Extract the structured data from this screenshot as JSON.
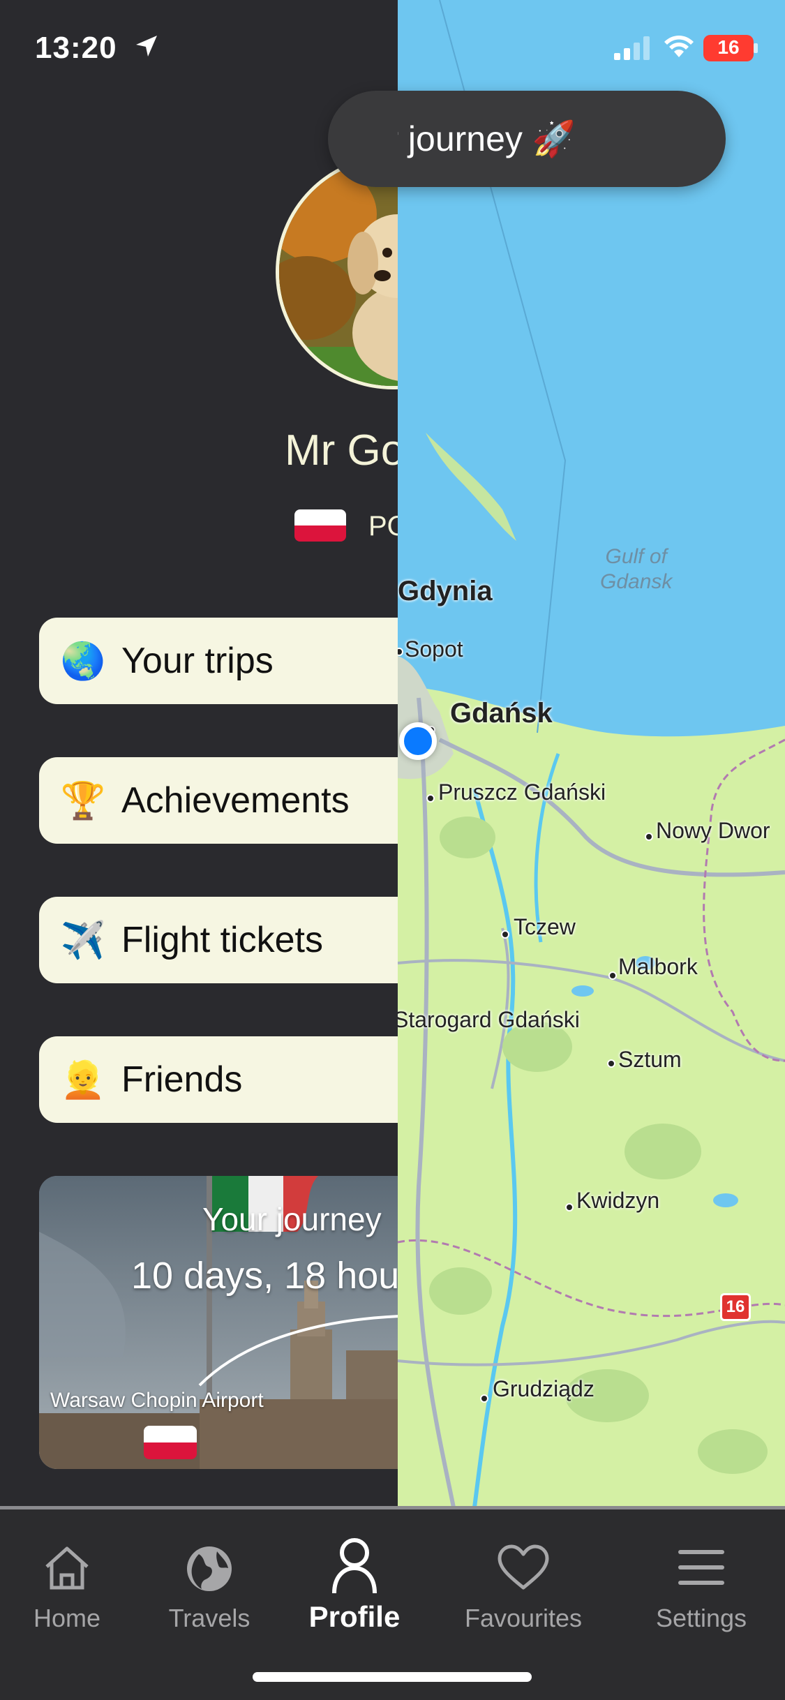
{
  "status_bar": {
    "time": "13:20",
    "battery": "16"
  },
  "journey_banner": {
    "text": "Your journey 🚀"
  },
  "profile": {
    "name": "Mr Go",
    "country_code": "PO",
    "flag_colors": [
      "#ffffff",
      "#dc143c"
    ]
  },
  "menu": [
    {
      "emoji": "🌏",
      "label": "Your trips"
    },
    {
      "emoji": "🏆",
      "label": "Achievements"
    },
    {
      "emoji": "✈️",
      "label": "Flight tickets"
    },
    {
      "emoji": "👱",
      "label": "Friends"
    }
  ],
  "journey_card": {
    "title": "Your journey",
    "duration": "10 days, 18 hou",
    "from": "Warsaw Chopin Airport"
  },
  "map": {
    "water_label": "Gulf of\nGdansk",
    "places": [
      {
        "name": "Gdynia"
      },
      {
        "name": "Sopot"
      },
      {
        "name": "Gdańsk"
      },
      {
        "name": "Pruszcz Gdański"
      },
      {
        "name": "Nowy Dwor"
      },
      {
        "name": "Tczew"
      },
      {
        "name": "Malbork"
      },
      {
        "name": "Starogard Gdański"
      },
      {
        "name": "Sztum"
      },
      {
        "name": "Kwidzyn"
      },
      {
        "name": "Grudziądz"
      }
    ],
    "road_shield": "16"
  },
  "tab_bar": {
    "tabs": [
      {
        "label": "Home",
        "icon": "home-icon"
      },
      {
        "label": "Travels",
        "icon": "globe-icon"
      },
      {
        "label": "Profile",
        "icon": "person-icon",
        "active": true
      },
      {
        "label": "Favourites",
        "icon": "heart-icon"
      },
      {
        "label": "Settings",
        "icon": "menu-icon"
      }
    ]
  },
  "colors": {
    "accent_button_bg": "#f6f6e2",
    "panel_bg": "#2a2a2e",
    "user_location": "#0a7aff"
  }
}
